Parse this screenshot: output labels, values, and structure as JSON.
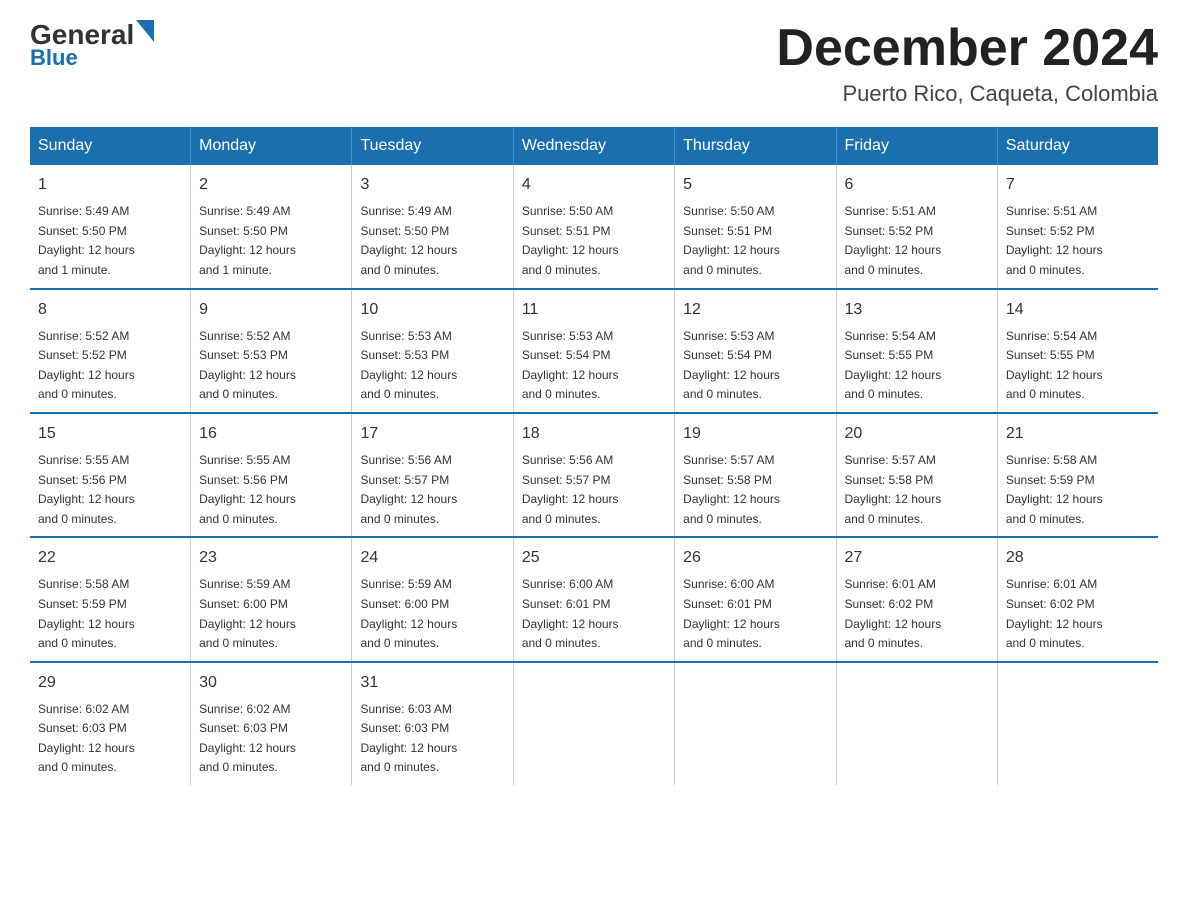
{
  "header": {
    "logo_general": "General",
    "logo_blue": "Blue",
    "title": "December 2024",
    "subtitle": "Puerto Rico, Caqueta, Colombia"
  },
  "days_of_week": [
    "Sunday",
    "Monday",
    "Tuesday",
    "Wednesday",
    "Thursday",
    "Friday",
    "Saturday"
  ],
  "weeks": [
    [
      {
        "day": "1",
        "sunrise": "5:49 AM",
        "sunset": "5:50 PM",
        "daylight": "12 hours and 1 minute."
      },
      {
        "day": "2",
        "sunrise": "5:49 AM",
        "sunset": "5:50 PM",
        "daylight": "12 hours and 1 minute."
      },
      {
        "day": "3",
        "sunrise": "5:49 AM",
        "sunset": "5:50 PM",
        "daylight": "12 hours and 0 minutes."
      },
      {
        "day": "4",
        "sunrise": "5:50 AM",
        "sunset": "5:51 PM",
        "daylight": "12 hours and 0 minutes."
      },
      {
        "day": "5",
        "sunrise": "5:50 AM",
        "sunset": "5:51 PM",
        "daylight": "12 hours and 0 minutes."
      },
      {
        "day": "6",
        "sunrise": "5:51 AM",
        "sunset": "5:52 PM",
        "daylight": "12 hours and 0 minutes."
      },
      {
        "day": "7",
        "sunrise": "5:51 AM",
        "sunset": "5:52 PM",
        "daylight": "12 hours and 0 minutes."
      }
    ],
    [
      {
        "day": "8",
        "sunrise": "5:52 AM",
        "sunset": "5:52 PM",
        "daylight": "12 hours and 0 minutes."
      },
      {
        "day": "9",
        "sunrise": "5:52 AM",
        "sunset": "5:53 PM",
        "daylight": "12 hours and 0 minutes."
      },
      {
        "day": "10",
        "sunrise": "5:53 AM",
        "sunset": "5:53 PM",
        "daylight": "12 hours and 0 minutes."
      },
      {
        "day": "11",
        "sunrise": "5:53 AM",
        "sunset": "5:54 PM",
        "daylight": "12 hours and 0 minutes."
      },
      {
        "day": "12",
        "sunrise": "5:53 AM",
        "sunset": "5:54 PM",
        "daylight": "12 hours and 0 minutes."
      },
      {
        "day": "13",
        "sunrise": "5:54 AM",
        "sunset": "5:55 PM",
        "daylight": "12 hours and 0 minutes."
      },
      {
        "day": "14",
        "sunrise": "5:54 AM",
        "sunset": "5:55 PM",
        "daylight": "12 hours and 0 minutes."
      }
    ],
    [
      {
        "day": "15",
        "sunrise": "5:55 AM",
        "sunset": "5:56 PM",
        "daylight": "12 hours and 0 minutes."
      },
      {
        "day": "16",
        "sunrise": "5:55 AM",
        "sunset": "5:56 PM",
        "daylight": "12 hours and 0 minutes."
      },
      {
        "day": "17",
        "sunrise": "5:56 AM",
        "sunset": "5:57 PM",
        "daylight": "12 hours and 0 minutes."
      },
      {
        "day": "18",
        "sunrise": "5:56 AM",
        "sunset": "5:57 PM",
        "daylight": "12 hours and 0 minutes."
      },
      {
        "day": "19",
        "sunrise": "5:57 AM",
        "sunset": "5:58 PM",
        "daylight": "12 hours and 0 minutes."
      },
      {
        "day": "20",
        "sunrise": "5:57 AM",
        "sunset": "5:58 PM",
        "daylight": "12 hours and 0 minutes."
      },
      {
        "day": "21",
        "sunrise": "5:58 AM",
        "sunset": "5:59 PM",
        "daylight": "12 hours and 0 minutes."
      }
    ],
    [
      {
        "day": "22",
        "sunrise": "5:58 AM",
        "sunset": "5:59 PM",
        "daylight": "12 hours and 0 minutes."
      },
      {
        "day": "23",
        "sunrise": "5:59 AM",
        "sunset": "6:00 PM",
        "daylight": "12 hours and 0 minutes."
      },
      {
        "day": "24",
        "sunrise": "5:59 AM",
        "sunset": "6:00 PM",
        "daylight": "12 hours and 0 minutes."
      },
      {
        "day": "25",
        "sunrise": "6:00 AM",
        "sunset": "6:01 PM",
        "daylight": "12 hours and 0 minutes."
      },
      {
        "day": "26",
        "sunrise": "6:00 AM",
        "sunset": "6:01 PM",
        "daylight": "12 hours and 0 minutes."
      },
      {
        "day": "27",
        "sunrise": "6:01 AM",
        "sunset": "6:02 PM",
        "daylight": "12 hours and 0 minutes."
      },
      {
        "day": "28",
        "sunrise": "6:01 AM",
        "sunset": "6:02 PM",
        "daylight": "12 hours and 0 minutes."
      }
    ],
    [
      {
        "day": "29",
        "sunrise": "6:02 AM",
        "sunset": "6:03 PM",
        "daylight": "12 hours and 0 minutes."
      },
      {
        "day": "30",
        "sunrise": "6:02 AM",
        "sunset": "6:03 PM",
        "daylight": "12 hours and 0 minutes."
      },
      {
        "day": "31",
        "sunrise": "6:03 AM",
        "sunset": "6:03 PM",
        "daylight": "12 hours and 0 minutes."
      },
      {
        "day": "",
        "sunrise": "",
        "sunset": "",
        "daylight": ""
      },
      {
        "day": "",
        "sunrise": "",
        "sunset": "",
        "daylight": ""
      },
      {
        "day": "",
        "sunrise": "",
        "sunset": "",
        "daylight": ""
      },
      {
        "day": "",
        "sunrise": "",
        "sunset": "",
        "daylight": ""
      }
    ]
  ],
  "labels": {
    "sunrise": "Sunrise:",
    "sunset": "Sunset:",
    "daylight": "Daylight:"
  }
}
